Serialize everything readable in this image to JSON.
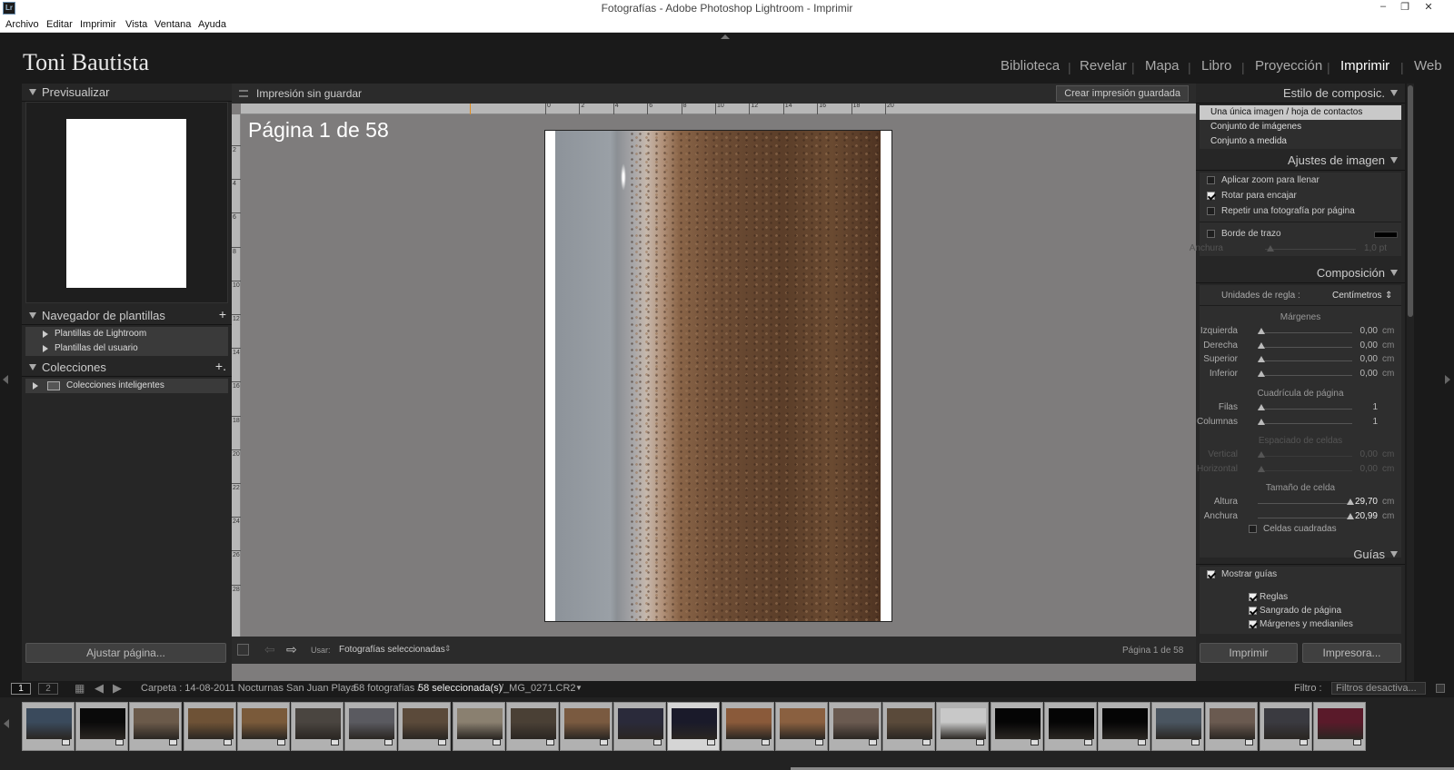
{
  "window": {
    "title": "Fotografías - Adobe Photoshop Lightroom - Imprimir",
    "app_icon": "Lr"
  },
  "menu": [
    "Archivo",
    "Editar",
    "Imprimir",
    "Vista",
    "Ventana",
    "Ayuda"
  ],
  "identity_plate": "Toni Bautista",
  "modules": [
    {
      "label": "Biblioteca",
      "active": false
    },
    {
      "label": "Revelar",
      "active": false
    },
    {
      "label": "Mapa",
      "active": false
    },
    {
      "label": "Libro",
      "active": false
    },
    {
      "label": "Proyección",
      "active": false
    },
    {
      "label": "Imprimir",
      "active": true
    },
    {
      "label": "Web",
      "active": false
    }
  ],
  "left_panel": {
    "preview_title": "Previsualizar",
    "templates_title": "Navegador de plantillas",
    "templates": [
      "Plantillas de Lightroom",
      "Plantillas del usuario"
    ],
    "collections_title": "Colecciones",
    "collections": [
      "Colecciones inteligentes"
    ],
    "page_setup_button": "Ajustar página..."
  },
  "center": {
    "print_name": "Impresión sin guardar",
    "save_button": "Crear impresión guardada",
    "page_label": "Página 1 de 58",
    "ruler_ticks": [
      "0",
      "2",
      "4",
      "6",
      "8",
      "10",
      "12",
      "14",
      "16",
      "18",
      "20"
    ],
    "vruler_ticks": [
      "2",
      "4",
      "6",
      "8",
      "10",
      "12",
      "14",
      "16",
      "18",
      "20",
      "22",
      "24",
      "26",
      "28"
    ],
    "use_label": "Usar:",
    "use_value": "Fotografías seleccionadas",
    "page_status": "Página 1 de 58"
  },
  "right_panel": {
    "layout_style": {
      "title": "Estilo de composic.",
      "options": [
        "Una única imagen / hoja de contactos",
        "Conjunto de imágenes",
        "Conjunto a medida"
      ],
      "selected": 0
    },
    "image_settings": {
      "title": "Ajustes de imagen",
      "zoom_to_fill": {
        "label": "Aplicar zoom para llenar",
        "checked": false
      },
      "rotate_to_fit": {
        "label": "Rotar para encajar",
        "checked": true
      },
      "repeat_one": {
        "label": "Repetir una fotografía por página",
        "checked": false
      },
      "stroke_border": {
        "label": "Borde de trazo",
        "checked": false
      },
      "stroke_color": "#000000",
      "width_label": "Anchura",
      "width_value": "1,0 pt"
    },
    "layout": {
      "title": "Composición",
      "ruler_units_label": "Unidades de regla :",
      "ruler_units_value": "Centímetros",
      "margins_title": "Márgenes",
      "margins": [
        {
          "label": "Izquierda",
          "value": "0,00",
          "unit": "cm"
        },
        {
          "label": "Derecha",
          "value": "0,00",
          "unit": "cm"
        },
        {
          "label": "Superior",
          "value": "0,00",
          "unit": "cm"
        },
        {
          "label": "Inferior",
          "value": "0,00",
          "unit": "cm"
        }
      ],
      "grid_title": "Cuadrícula de página",
      "grid": [
        {
          "label": "Filas",
          "value": "1"
        },
        {
          "label": "Columnas",
          "value": "1"
        }
      ],
      "spacing_title": "Espaciado de celdas",
      "spacing": [
        {
          "label": "Vertical",
          "value": "0,00",
          "unit": "cm"
        },
        {
          "label": "Horizontal",
          "value": "0,00",
          "unit": "cm"
        }
      ],
      "cell_size_title": "Tamaño de celda",
      "cell_size": [
        {
          "label": "Altura",
          "value": "29,70",
          "unit": "cm"
        },
        {
          "label": "Anchura",
          "value": "20,99",
          "unit": "cm"
        }
      ],
      "square_cells": {
        "label": "Celdas cuadradas",
        "checked": false
      }
    },
    "guides": {
      "title": "Guías",
      "show_guides": {
        "label": "Mostrar guías",
        "checked": true
      },
      "items": [
        {
          "label": "Reglas",
          "checked": true
        },
        {
          "label": "Sangrado de página",
          "checked": true
        },
        {
          "label": "Márgenes y medianiles",
          "checked": true
        }
      ]
    },
    "print_button": "Imprimir",
    "printer_button": "Impresora..."
  },
  "filmstrip_bar": {
    "screen1": "1",
    "screen2": "2",
    "source_path": "Carpeta : 14-08-2011 Nocturnas San Juan Playa",
    "count": "58 fotografías /",
    "selected": "58 seleccionada(s)",
    "filename": "/_MG_0271.CR2",
    "filter_label": "Filtro :",
    "filter_value": "Filtros desactiva..."
  },
  "filmstrip_colors": [
    "#3a4a5c",
    "#0a0a0a",
    "#6b5a4a",
    "#6e5236",
    "#7a5a3a",
    "#4a4540",
    "#5a5a60",
    "#5b4a3a",
    "#8a8070",
    "#4a4035",
    "#7a5a40",
    "#2a2a3a",
    "#1a1a2a",
    "#8a5a3a",
    "#8a6040",
    "#6a5a50",
    "#5a4a3a",
    "#c8c8c8",
    "#050505",
    "#050505",
    "#050505",
    "#4a5560",
    "#6a5a50",
    "#3a3a40",
    "#5a1a2a"
  ],
  "filmstrip_selected_index": 12
}
